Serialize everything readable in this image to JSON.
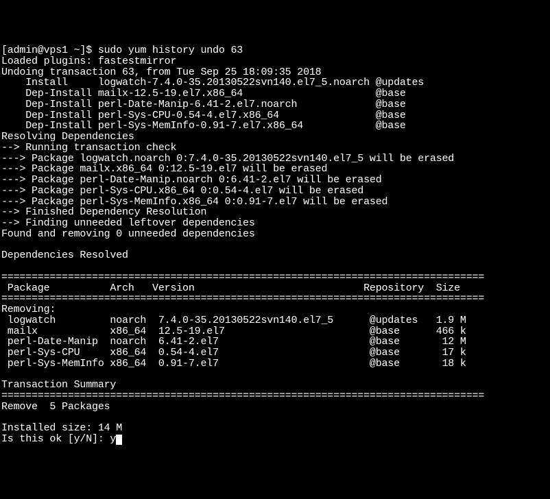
{
  "prompt": {
    "user_host": "[admin@vps1 ~]$ ",
    "command": "sudo yum history undo 63"
  },
  "output": {
    "line1": "Loaded plugins: fastestmirror",
    "line2": "Undoing transaction 63, from Tue Sep 25 18:09:35 2018",
    "line3": "    Install     logwatch-7.4.0-35.20130522svn140.el7_5.noarch @updates",
    "line4": "    Dep-Install mailx-12.5-19.el7.x86_64                      @base",
    "line5": "    Dep-Install perl-Date-Manip-6.41-2.el7.noarch             @base",
    "line6": "    Dep-Install perl-Sys-CPU-0.54-4.el7.x86_64                @base",
    "line7": "    Dep-Install perl-Sys-MemInfo-0.91-7.el7.x86_64            @base",
    "line8": "Resolving Dependencies",
    "line9": "--> Running transaction check",
    "line10": "---> Package logwatch.noarch 0:7.4.0-35.20130522svn140.el7_5 will be erased",
    "line11": "---> Package mailx.x86_64 0:12.5-19.el7 will be erased",
    "line12": "---> Package perl-Date-Manip.noarch 0:6.41-2.el7 will be erased",
    "line13": "---> Package perl-Sys-CPU.x86_64 0:0.54-4.el7 will be erased",
    "line14": "---> Package perl-Sys-MemInfo.x86_64 0:0.91-7.el7 will be erased",
    "line15": "--> Finished Dependency Resolution",
    "line16": "--> Finding unneeded leftover dependencies",
    "line17": "Found and removing 0 unneeded dependencies",
    "line18": "",
    "line19": "Dependencies Resolved",
    "line20": "",
    "divider": "================================================================================",
    "header": " Package          Arch   Version                            Repository  Size",
    "removing": "Removing:",
    "row1": " logwatch         noarch  7.4.0-35.20130522svn140.el7_5      @updates   1.9 M",
    "row2": " mailx            x86_64  12.5-19.el7                        @base      466 k",
    "row3": " perl-Date-Manip  noarch  6.41-2.el7                         @base       12 M",
    "row4": " perl-Sys-CPU     x86_64  0.54-4.el7                         @base       17 k",
    "row5": " perl-Sys-MemInfo x86_64  0.91-7.el7                         @base       18 k",
    "line21": "",
    "summary": "Transaction Summary",
    "remove": "Remove  5 Packages",
    "installed": "Installed size: 14 M",
    "confirm": "Is this ok [y/N]: y"
  }
}
